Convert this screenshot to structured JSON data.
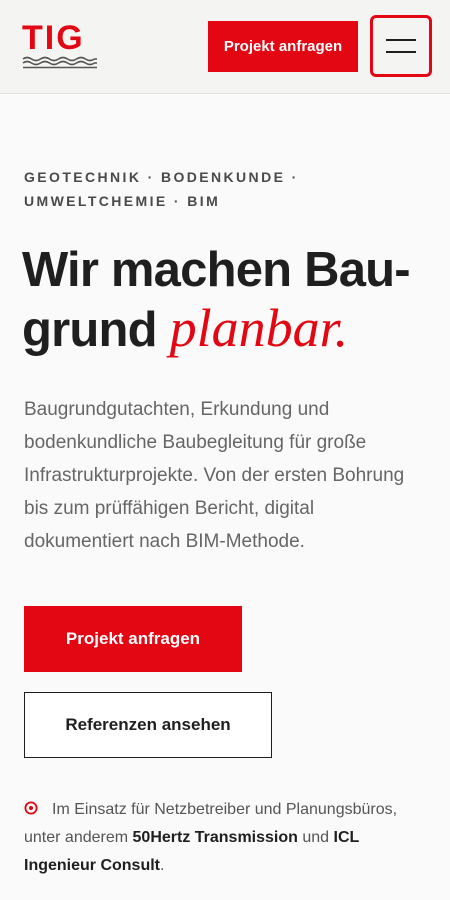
{
  "header": {
    "logo_text": "TIG",
    "cta_label": "Projekt anfragen",
    "menu_icon": "hamburger-icon"
  },
  "hero": {
    "eyebrow_line1": "GEOTECHNIK · BODENKUNDE ·",
    "eyebrow_line2": "UMWELTCHEMIE · BIM",
    "headline_line1": "Wir machen Bau-",
    "headline_line2_plain": "grund ",
    "headline_line2_accent": "planbar.",
    "lead": "Baugrundgutachten, Erkundung und bodenkundliche Baubegleitung für große Infrastrukturprojekte. Von der ersten Bohrung bis zum prüffähigen Bericht, digital dokumentiert nach BIM-Methode.",
    "primary_cta": "Projekt anfragen",
    "secondary_cta": "Referenzen ansehen"
  },
  "trust": {
    "icon": "target-icon",
    "text_before": "Im Einsatz für Netzbetreiber und Planungsbüros, unter anderem ",
    "client_1": "50Hertz Transmission",
    "text_middle": " und ",
    "client_2": "ICL Ingenieur Consult",
    "text_after": "."
  },
  "colors": {
    "accent": "#e30613",
    "text_dark": "#1f1f1f",
    "text_muted": "#666666",
    "header_bg": "#f4f4f2"
  }
}
